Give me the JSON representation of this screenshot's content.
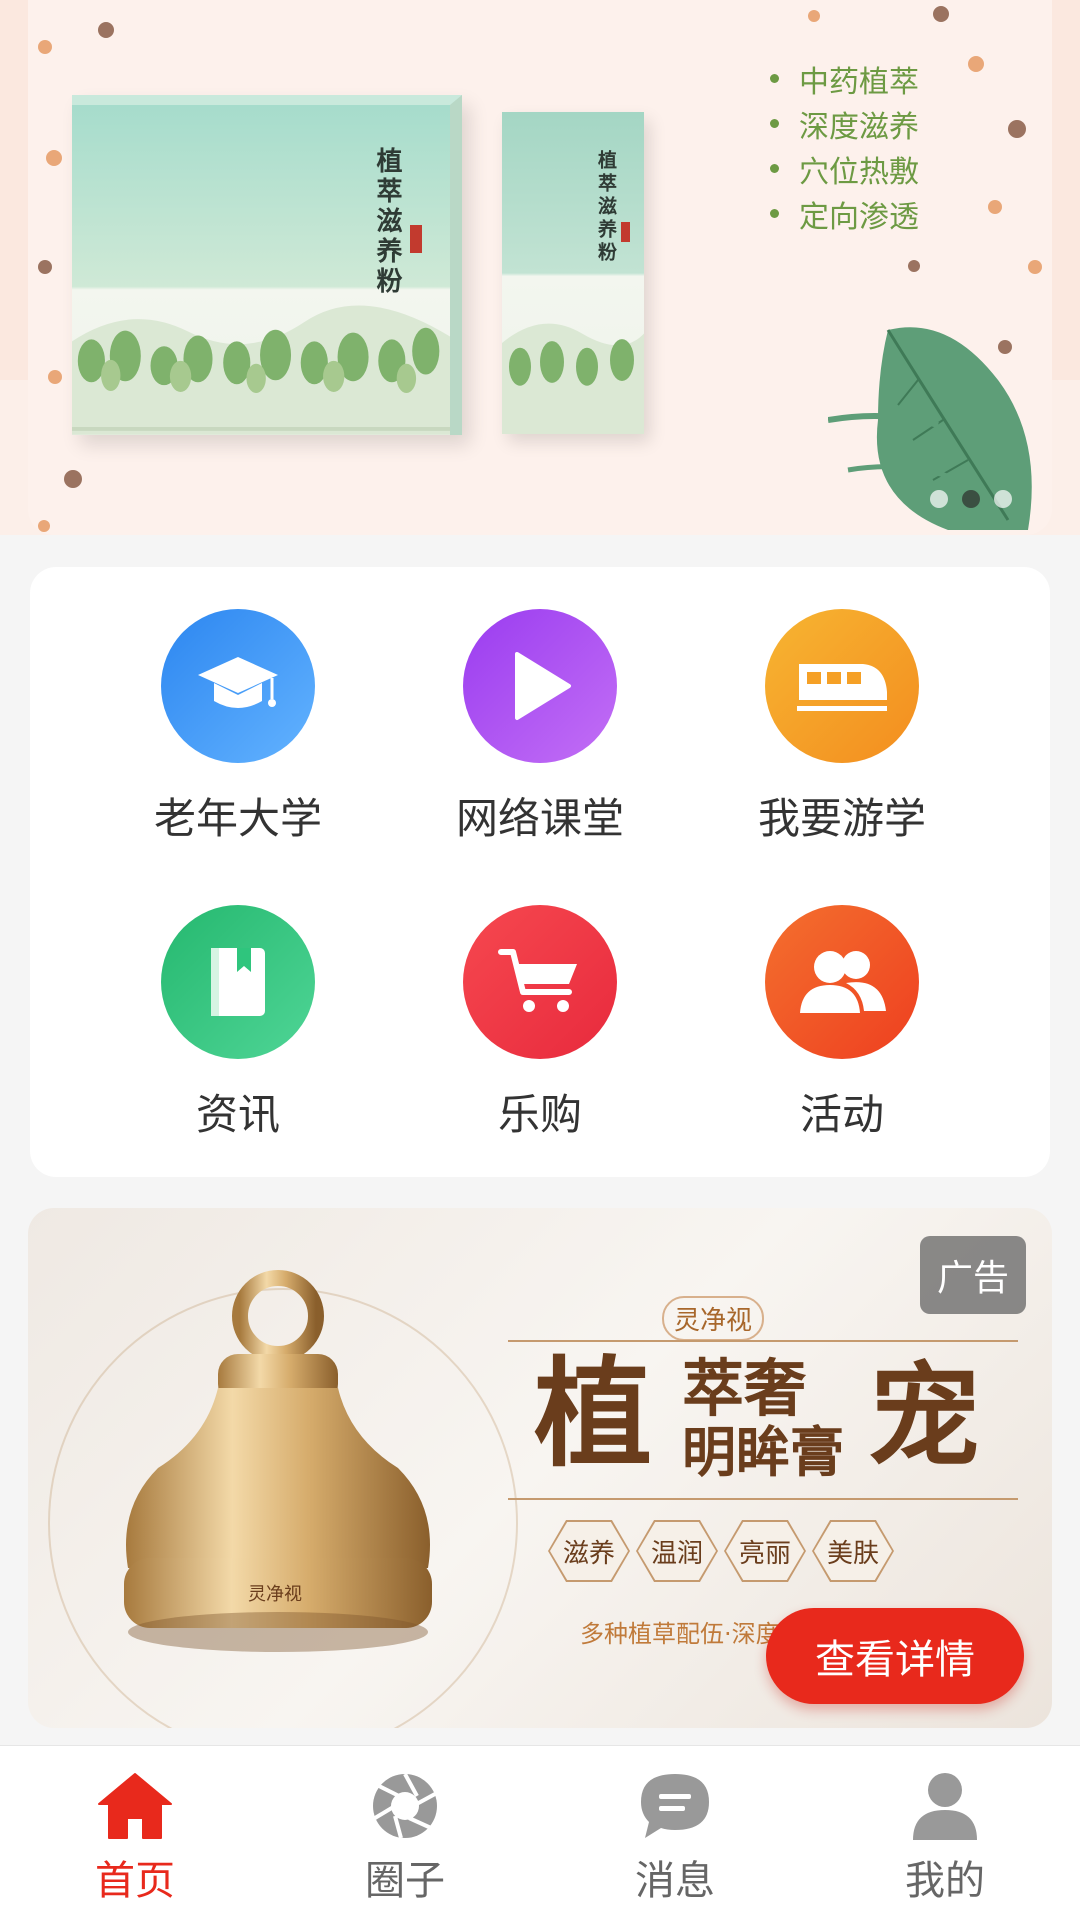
{
  "banner": {
    "product_box_title": "植萃滋养粉",
    "product_pouch_title": "植萃滋养粉",
    "features": [
      "中药植萃",
      "深度滋养",
      "穴位热敷",
      "定向渗透"
    ],
    "indicator_count": 3,
    "active_indicator": 1
  },
  "grid": {
    "items": [
      {
        "label": "老年大学",
        "icon": "graduation-cap-icon",
        "color": "#3d96f5"
      },
      {
        "label": "网络课堂",
        "icon": "play-icon",
        "color": "#a64ef0"
      },
      {
        "label": "我要游学",
        "icon": "train-icon",
        "color": "#f6a12a"
      },
      {
        "label": "资讯",
        "icon": "book-icon",
        "color": "#2fc57d"
      },
      {
        "label": "乐购",
        "icon": "shopping-cart-icon",
        "color": "#f0384a"
      },
      {
        "label": "活动",
        "icon": "users-icon",
        "color": "#f25a28"
      }
    ]
  },
  "ad": {
    "badge": "广告",
    "brand": "灵净视",
    "headline_1": "植",
    "headline_2": "萃奢",
    "headline_3": "明眸膏",
    "headline_4": "宠",
    "tags": [
      "滋养",
      "温润",
      "亮丽",
      "美肤"
    ],
    "subtitle": "多种植草配伍·深度",
    "product_label": "灵净视",
    "cta": "查看详情"
  },
  "tabbar": {
    "tabs": [
      {
        "label": "首页",
        "icon": "home-icon",
        "active": true
      },
      {
        "label": "圈子",
        "icon": "aperture-icon",
        "active": false
      },
      {
        "label": "消息",
        "icon": "message-icon",
        "active": false
      },
      {
        "label": "我的",
        "icon": "user-icon",
        "active": false
      }
    ],
    "active_color": "#e8291c",
    "inactive_color": "#999999"
  }
}
